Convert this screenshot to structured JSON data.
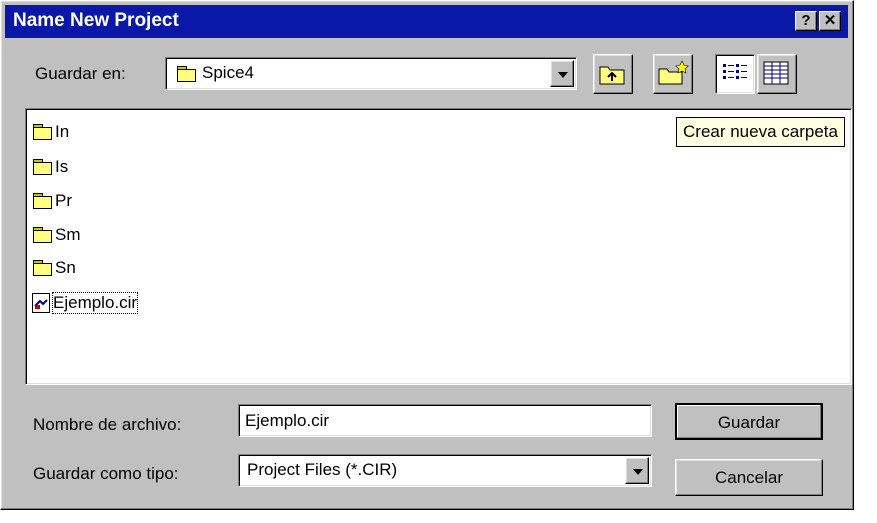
{
  "window": {
    "title": "Name New Project",
    "help_button": "?",
    "close_button": "✕"
  },
  "location": {
    "label": "Guardar en:",
    "value": "Spice4"
  },
  "toolbar": {
    "up_folder": "up-one-level-icon",
    "new_folder": "new-folder-icon",
    "list_view": "list-view-icon",
    "details_view": "details-view-icon"
  },
  "tooltip": "Crear nueva carpeta",
  "files": [
    {
      "name": "In",
      "type": "folder"
    },
    {
      "name": "Is",
      "type": "folder"
    },
    {
      "name": "Pr",
      "type": "folder"
    },
    {
      "name": "Sm",
      "type": "folder"
    },
    {
      "name": "Sn",
      "type": "folder"
    },
    {
      "name": "Ejemplo.cir",
      "type": "file"
    }
  ],
  "filename": {
    "label": "Nombre de archivo:",
    "value": "Ejemplo.cir"
  },
  "filetype": {
    "label": "Guardar como tipo:",
    "value": "Project Files (*.CIR)"
  },
  "buttons": {
    "save": "Guardar",
    "cancel": "Cancelar"
  }
}
